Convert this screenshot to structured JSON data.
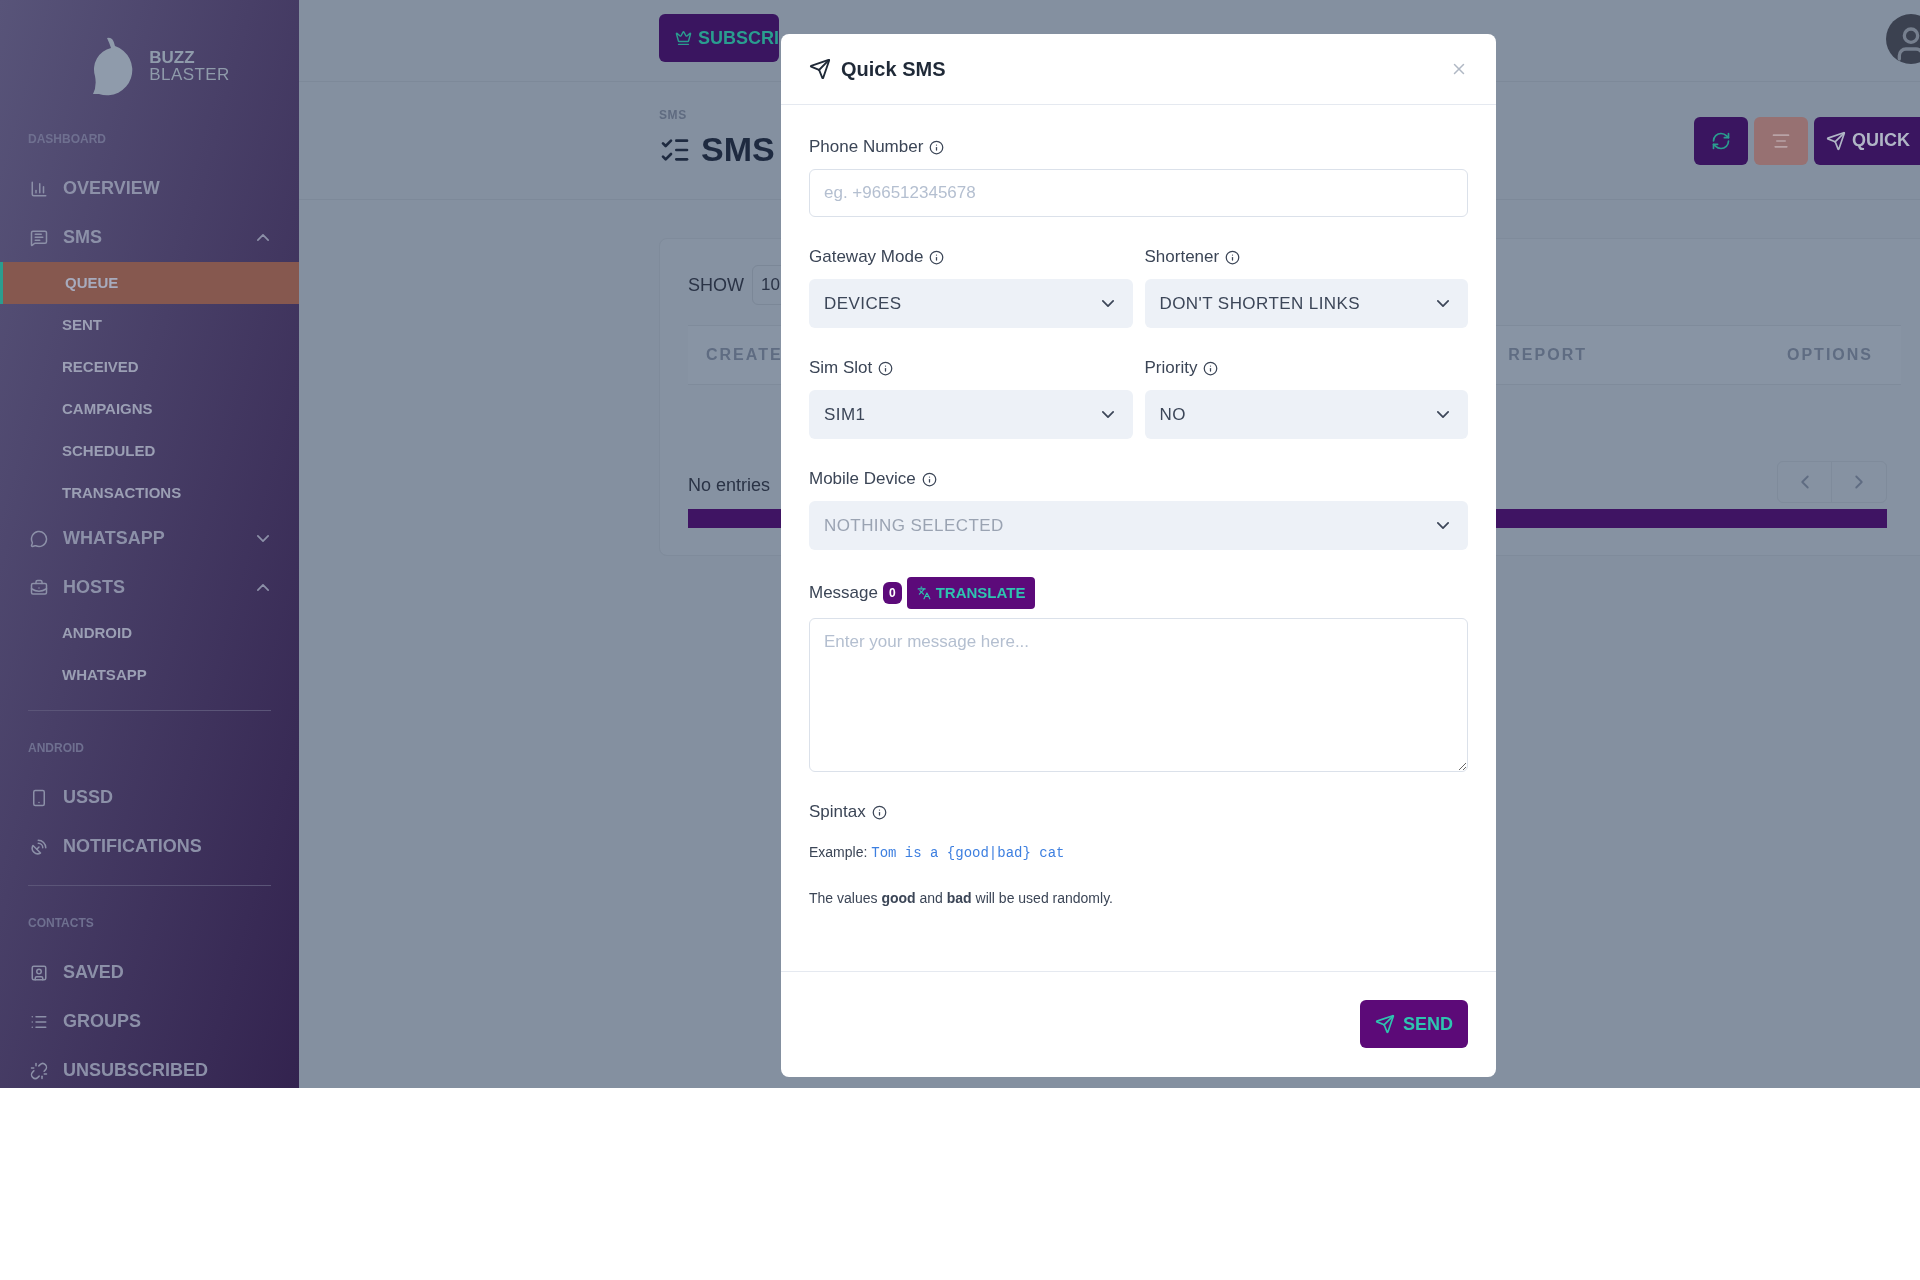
{
  "sidebar": {
    "brand": {
      "line_1": "BUZZ",
      "line_2": "BLASTER"
    },
    "sections": [
      {
        "title": "DASHBOARD",
        "items": [
          {
            "kind": "link",
            "label": "OVERVIEW"
          },
          {
            "kind": "group",
            "label": "SMS",
            "expanded": true,
            "children": [
              {
                "label": "QUEUE",
                "selected": true
              },
              {
                "label": "SENT",
                "selected": false
              },
              {
                "label": "RECEIVED",
                "selected": false
              },
              {
                "label": "CAMPAIGNS",
                "selected": false
              },
              {
                "label": "SCHEDULED",
                "selected": false
              },
              {
                "label": "TRANSACTIONS",
                "selected": false
              }
            ]
          },
          {
            "kind": "group",
            "label": "WHATSAPP",
            "expanded": false
          },
          {
            "kind": "group",
            "label": "HOSTS",
            "expanded": true,
            "children": [
              {
                "label": "ANDROID",
                "selected": false
              },
              {
                "label": "WHATSAPP",
                "selected": false
              }
            ]
          }
        ]
      },
      {
        "title": "ANDROID",
        "items": [
          {
            "kind": "link",
            "label": "USSD"
          },
          {
            "kind": "link",
            "label": "NOTIFICATIONS"
          }
        ]
      },
      {
        "title": "CONTACTS",
        "items": [
          {
            "kind": "link",
            "label": "SAVED"
          },
          {
            "kind": "link",
            "label": "GROUPS"
          },
          {
            "kind": "link",
            "label": "UNSUBSCRIBED"
          }
        ]
      }
    ]
  },
  "top_bar": {
    "buttons": [
      "SUBSCRI"
    ]
  },
  "page": {
    "breadcrumb": "SMS",
    "title": "SMS",
    "quick_button": "QUICK",
    "card": {
      "show_label": "SHOW",
      "page_size": "10",
      "columns": [
        "CREATE",
        "REPORT",
        "OPTIONS"
      ],
      "empty_text": "No entries"
    }
  },
  "modal": {
    "title": "Quick SMS",
    "rows": [
      [
        {
          "kind": "input",
          "label": "Phone Number",
          "placeholder": "eg. +966512345678"
        }
      ],
      [
        {
          "kind": "select",
          "label": "Gateway Mode",
          "value": "DEVICES"
        },
        {
          "kind": "select",
          "label": "Shortener",
          "value": "DON'T SHORTEN LINKS"
        }
      ],
      [
        {
          "kind": "select",
          "label": "Sim Slot",
          "value": "SIM1"
        },
        {
          "kind": "select",
          "label": "Priority",
          "value": "NO"
        }
      ],
      [
        {
          "kind": "select",
          "label": "Mobile Device",
          "placeholder": "NOTHING SELECTED"
        }
      ],
      [
        {
          "kind": "textarea",
          "label": "Message",
          "counter": "0",
          "action": "TRANSLATE",
          "placeholder": "Enter your message here..."
        }
      ]
    ],
    "spintax": {
      "label": "Spintax",
      "example_label": "Example:",
      "example_code": "Tom is a {good|bad} cat",
      "note": "The values **good** and **bad** will be used randomly."
    },
    "send_button": "SEND"
  }
}
